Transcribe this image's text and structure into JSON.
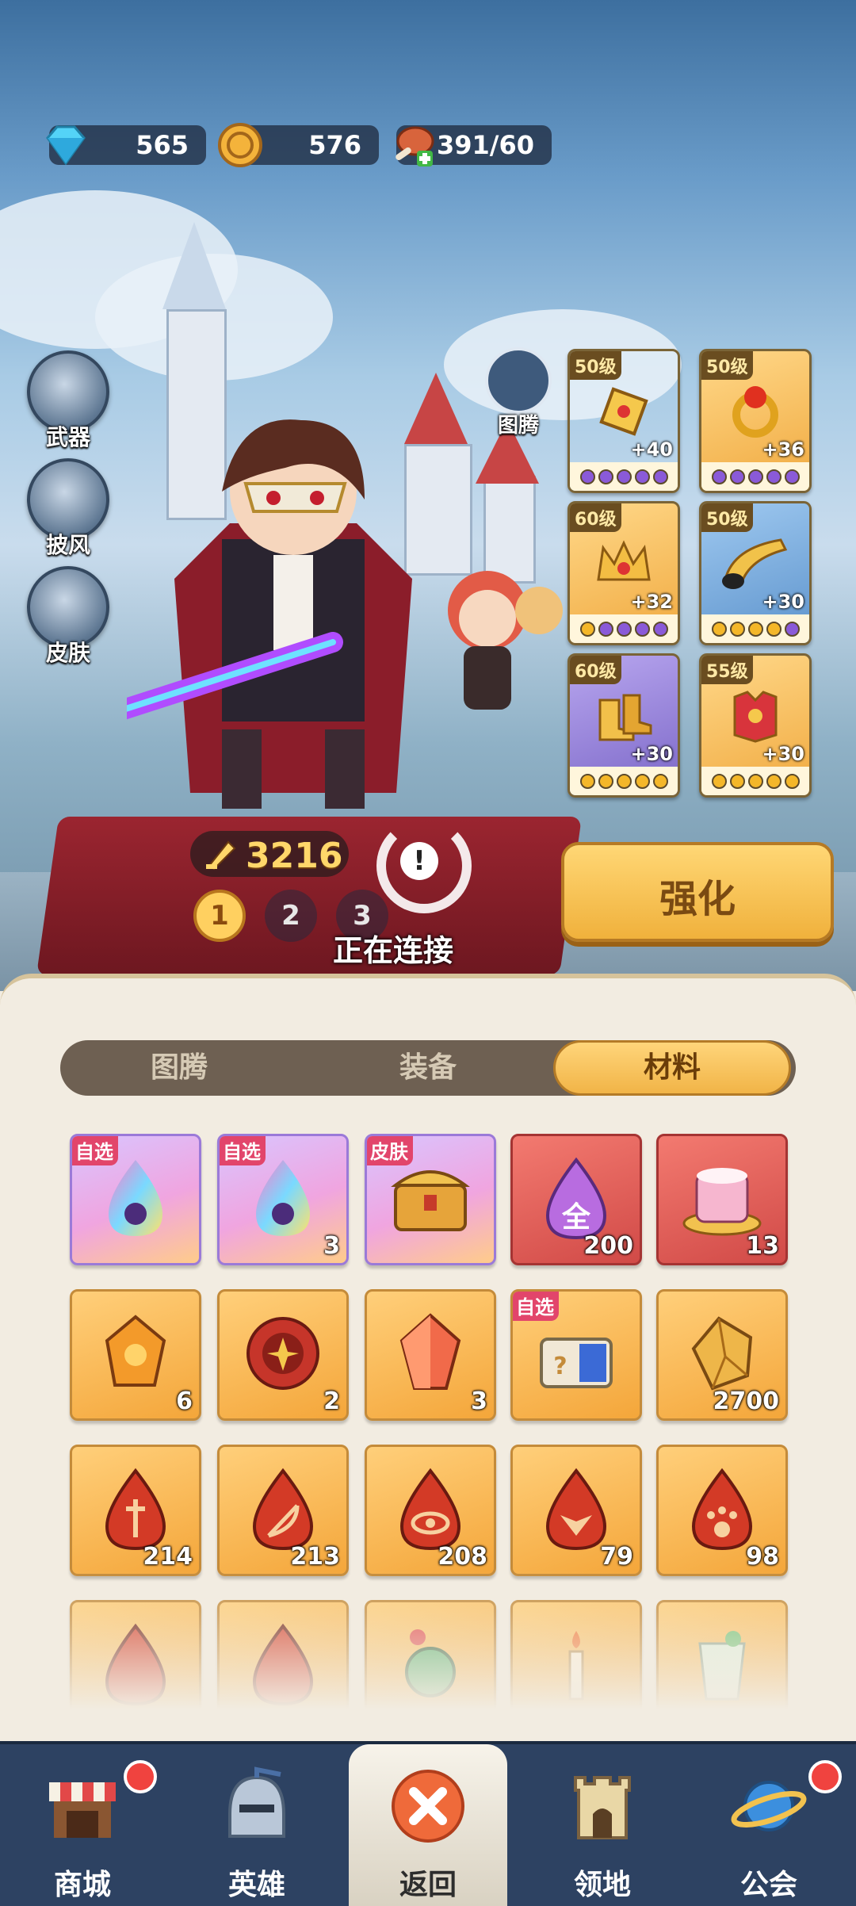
{
  "resources": [
    {
      "name": "diamond",
      "icon": "diamond-icon",
      "value": "565"
    },
    {
      "name": "gold",
      "icon": "coin-icon",
      "value": "576"
    },
    {
      "name": "stamina",
      "icon": "meat-icon",
      "value": "391/60"
    }
  ],
  "side_menu": [
    {
      "label": "武器",
      "icon": "weapon-icon"
    },
    {
      "label": "披风",
      "icon": "cloak-icon"
    },
    {
      "label": "皮肤",
      "icon": "skin-icon"
    }
  ],
  "totem": {
    "label": "图腾",
    "icon": "totem-icon"
  },
  "equipment": [
    {
      "level": "50级",
      "plus": "+40",
      "rarity": "purple",
      "dots": [
        "p",
        "p",
        "p",
        "p",
        "p"
      ]
    },
    {
      "level": "50级",
      "plus": "+36",
      "rarity": "gold",
      "dots": [
        "p",
        "p",
        "p",
        "p",
        "p"
      ]
    },
    {
      "level": "60级",
      "plus": "+32",
      "rarity": "gold",
      "dots": [
        "y",
        "p",
        "p",
        "p",
        "p"
      ]
    },
    {
      "level": "50级",
      "plus": "+30",
      "rarity": "blue",
      "dots": [
        "y",
        "y",
        "y",
        "y",
        "p"
      ]
    },
    {
      "level": "60级",
      "plus": "+30",
      "rarity": "purple",
      "dots": [
        "y",
        "y",
        "y",
        "y",
        "y"
      ]
    },
    {
      "level": "55级",
      "plus": "+30",
      "rarity": "gold",
      "dots": [
        "y",
        "y",
        "y",
        "y",
        "y"
      ]
    }
  ],
  "power": "3216",
  "loadout_pages": [
    "1",
    "2",
    "3"
  ],
  "connecting_text": "正在连接",
  "strengthen_label": "强化",
  "tabs": [
    {
      "label": "图腾",
      "active": false
    },
    {
      "label": "装备",
      "active": false
    },
    {
      "label": "材料",
      "active": true
    }
  ],
  "items": [
    {
      "tag": "自选",
      "count": "",
      "style": "rainbow",
      "icon": "rainbow-drop-icon"
    },
    {
      "tag": "自选",
      "count": "3",
      "style": "rainbow",
      "icon": "rainbow-drop-icon"
    },
    {
      "tag": "皮肤",
      "count": "",
      "style": "rainbow",
      "icon": "treasure-chest-icon"
    },
    {
      "tag": "",
      "count": "200",
      "style": "red",
      "icon": "all-drop-icon"
    },
    {
      "tag": "",
      "count": "13",
      "style": "red",
      "icon": "cake-hat-icon"
    },
    {
      "tag": "",
      "count": "6",
      "style": "gold",
      "icon": "amber-ore-icon"
    },
    {
      "tag": "",
      "count": "2",
      "style": "gold",
      "icon": "red-chip-icon"
    },
    {
      "tag": "",
      "count": "3",
      "style": "gold",
      "icon": "red-crystal-icon"
    },
    {
      "tag": "自选",
      "count": "",
      "style": "gold",
      "icon": "mystery-chest-icon"
    },
    {
      "tag": "",
      "count": "2700",
      "style": "gold",
      "icon": "gold-ore-icon"
    },
    {
      "tag": "",
      "count": "214",
      "style": "gold",
      "icon": "sword-drop-icon"
    },
    {
      "tag": "",
      "count": "213",
      "style": "gold",
      "icon": "bow-drop-icon"
    },
    {
      "tag": "",
      "count": "208",
      "style": "gold",
      "icon": "eye-drop-icon"
    },
    {
      "tag": "",
      "count": "79",
      "style": "gold",
      "icon": "wing-drop-icon"
    },
    {
      "tag": "",
      "count": "98",
      "style": "gold",
      "icon": "paw-drop-icon"
    },
    {
      "tag": "",
      "count": "",
      "style": "gold",
      "icon": "red-drop-icon"
    },
    {
      "tag": "",
      "count": "",
      "style": "gold",
      "icon": "red-drop-icon"
    },
    {
      "tag": "",
      "count": "",
      "style": "gold",
      "icon": "pendant-icon"
    },
    {
      "tag": "",
      "count": "",
      "style": "gold",
      "icon": "candle-icon"
    },
    {
      "tag": "",
      "count": "",
      "style": "gold",
      "icon": "drink-icon"
    }
  ],
  "nav": [
    {
      "label": "商城",
      "icon": "shop-icon",
      "badge": true,
      "active": false
    },
    {
      "label": "英雄",
      "icon": "helmet-icon",
      "badge": false,
      "active": false
    },
    {
      "label": "返回",
      "icon": "close-icon",
      "badge": false,
      "active": true
    },
    {
      "label": "领地",
      "icon": "castle-icon",
      "badge": false,
      "active": false
    },
    {
      "label": "公会",
      "icon": "planet-icon",
      "badge": true,
      "active": false
    }
  ],
  "colors": {
    "accent_gold": "#f1b447",
    "nav_bg": "#2d4262",
    "badge_red": "#f0433f",
    "tag_pink": "#e2456b"
  }
}
